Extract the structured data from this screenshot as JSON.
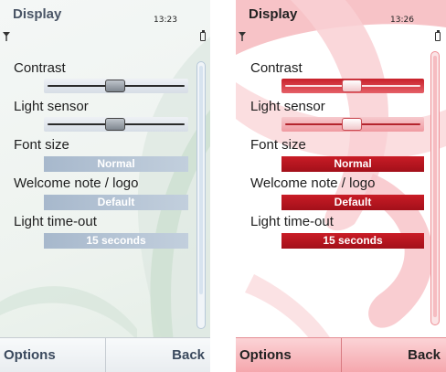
{
  "screens": [
    {
      "skin": "grey",
      "title": "Display",
      "clock": "13:23",
      "settings": [
        {
          "label": "Contrast",
          "type": "slider",
          "level": 0.49
        },
        {
          "label": "Light sensor",
          "type": "slider",
          "level": 0.49
        },
        {
          "label": "Font size",
          "type": "value",
          "value": "Normal"
        },
        {
          "label": "Welcome note / logo",
          "type": "value",
          "value": "Default"
        },
        {
          "label": "Light time-out",
          "type": "value",
          "value": "15 seconds"
        }
      ],
      "softkeys": {
        "left": "Options",
        "right": "Back"
      },
      "colors": {
        "title": "#4a5566",
        "value_box": "#a7b8cc",
        "softkey": "#3b4a5e"
      }
    },
    {
      "skin": "red",
      "title": "Display",
      "clock": "13:26",
      "settings": [
        {
          "label": "Contrast",
          "type": "slider",
          "level": 0.49
        },
        {
          "label": "Light sensor",
          "type": "slider",
          "level": 0.49
        },
        {
          "label": "Font size",
          "type": "value",
          "value": "Normal"
        },
        {
          "label": "Welcome note / logo",
          "type": "value",
          "value": "Default"
        },
        {
          "label": "Light time-out",
          "type": "value",
          "value": "15 seconds"
        }
      ],
      "softkeys": {
        "left": "Options",
        "right": "Back"
      },
      "colors": {
        "title": "#222222",
        "value_box": "#c91c26",
        "slider": "#c8202a",
        "softkey": "#222222"
      }
    }
  ],
  "icons": {
    "signal": "signal-icon",
    "battery": "battery-icon"
  }
}
